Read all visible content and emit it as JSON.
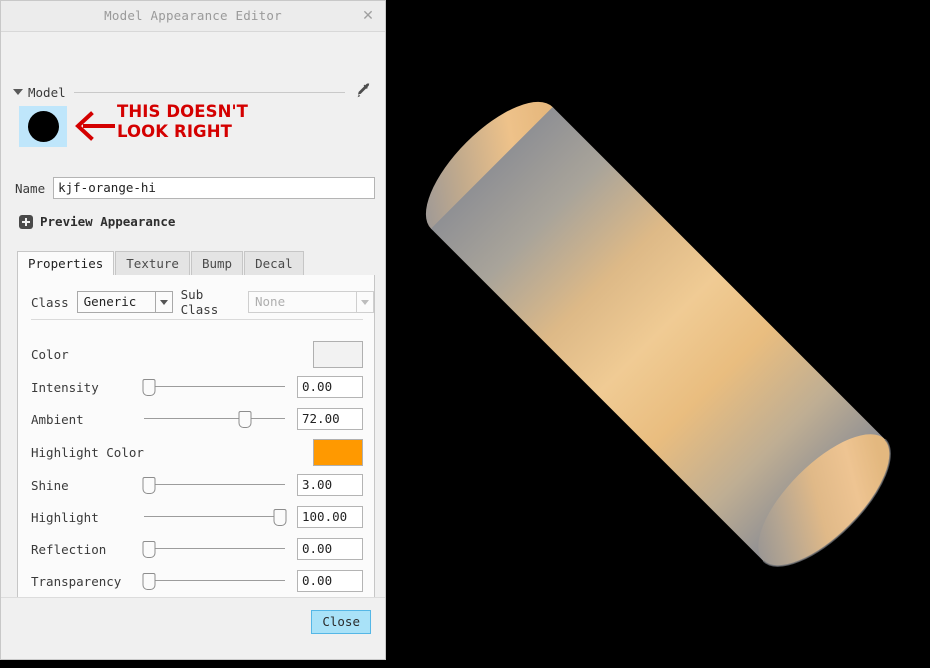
{
  "window": {
    "title": "Model Appearance Editor",
    "close_icon": "close-x-icon"
  },
  "model_group": {
    "label": "Model",
    "collapse_icon": "chevron-down-icon",
    "eyedropper_icon": "eyedropper-icon",
    "swatch_color": "#000000",
    "swatch_selection_color": "#bfe6fb"
  },
  "annotation": {
    "text": "THIS DOESN'T\nLOOK RIGHT",
    "color": "#d40000",
    "arrow_icon": "left-arrow-icon"
  },
  "name_field": {
    "label": "Name",
    "value": "kjf-orange-hi",
    "placeholder": ""
  },
  "preview": {
    "label": "Preview Appearance",
    "expand_icon": "plus-icon",
    "expanded": false
  },
  "tabs": [
    {
      "label": "Properties",
      "active": true
    },
    {
      "label": "Texture",
      "active": false
    },
    {
      "label": "Bump",
      "active": false
    },
    {
      "label": "Decal",
      "active": false
    }
  ],
  "class_row": {
    "class_label": "Class",
    "class_value": "Generic",
    "sub_class_label": "Sub Class",
    "sub_class_value": "None",
    "sub_class_disabled": true
  },
  "properties": [
    {
      "label": "Color",
      "kind": "color",
      "color": "#f2f2f2"
    },
    {
      "label": "Intensity",
      "kind": "slider",
      "value": "0.00",
      "percent": 3
    },
    {
      "label": "Ambient",
      "kind": "slider",
      "value": "72.00",
      "percent": 72
    },
    {
      "label": "Highlight Color",
      "kind": "color",
      "color": "#ff9900"
    },
    {
      "label": "Shine",
      "kind": "slider",
      "value": "3.00",
      "percent": 3
    },
    {
      "label": "Highlight",
      "kind": "slider",
      "value": "100.00",
      "percent": 97
    },
    {
      "label": "Reflection",
      "kind": "slider",
      "value": "0.00",
      "percent": 3
    },
    {
      "label": "Transparency",
      "kind": "slider",
      "value": "0.00",
      "percent": 3
    }
  ],
  "footer": {
    "close_label": "Close"
  },
  "viewport": {
    "background": "#000000",
    "object": "cylinder",
    "body_color": "#e8b976",
    "shade_color": "#8f9094",
    "highlight_color": "#f5cf93"
  }
}
